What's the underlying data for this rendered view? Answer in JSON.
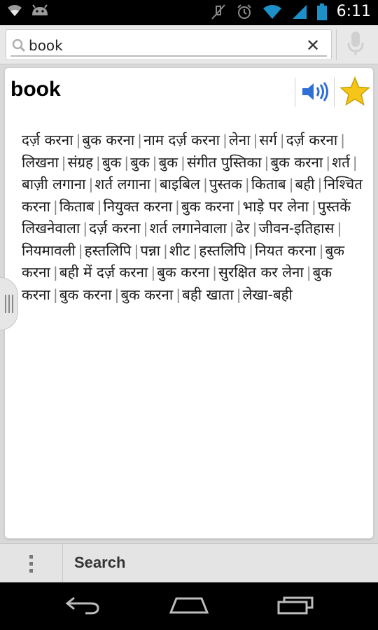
{
  "status_bar": {
    "time": "6:11",
    "icons": [
      "wifi-icon",
      "android-icon",
      "mute-icon",
      "alarm-icon",
      "wifi-signal-icon",
      "cell-signal-icon",
      "battery-icon"
    ]
  },
  "search": {
    "value": "book",
    "clear_label": "✕"
  },
  "entry": {
    "word": "book",
    "meanings": [
      "दर्ज़ करना",
      "बुक करना",
      "नाम दर्ज़ करना",
      "लेना",
      "सर्ग",
      "दर्ज़ करना",
      "लिखना",
      "संग्रह",
      "बुक",
      "बुक",
      "बुक",
      "संगीत पुस्तिका",
      "बुक करना",
      "शर्त",
      "बाज़ी लगाना",
      "शर्त लगाना",
      "बाइबिल",
      "पुस्तक",
      "किताब",
      "बही",
      "निश्चित करना",
      "किताब",
      "नियुक्त करना",
      "बुक करना",
      "भाड़े पर लेना",
      "पुस्तकें लिखनेवाला",
      "दर्ज़ करना",
      "शर्त लगानेवाला",
      "ढेर",
      "जीवन-इतिहास",
      "नियमावली",
      "हस्तलिपि",
      "पन्ना",
      "शीट",
      "हस्तलिपि",
      "नियत करना",
      "बुक करना",
      "बही में दर्ज़ करना",
      "बुक करना",
      "सुरक्षित कर लेना",
      "बुक करना",
      "बुक करना",
      "बुक करना",
      "बही खाता",
      "लेखा-बही"
    ],
    "separator": "|"
  },
  "action_bar": {
    "search_label": "Search"
  },
  "colors": {
    "favorite_star": "#f5c518",
    "speaker": "#2f6fd6"
  }
}
